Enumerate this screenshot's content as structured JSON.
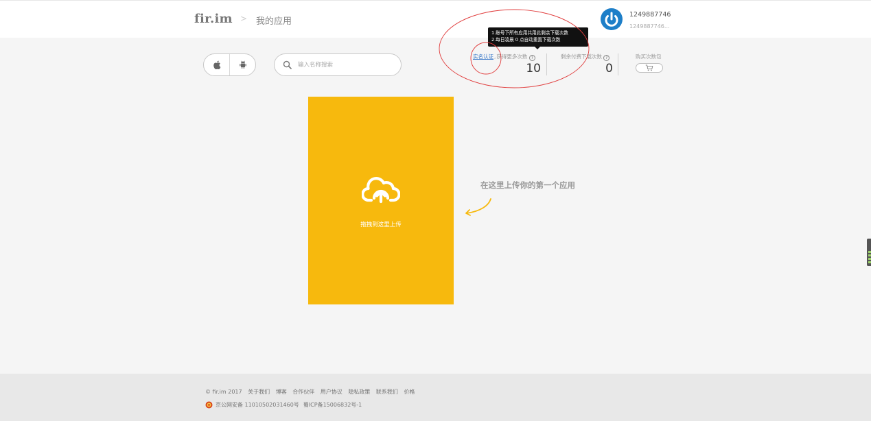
{
  "header": {
    "logo": "fir.im",
    "breadcrumb_separator": ">",
    "page_title": "我的应用",
    "user": {
      "name": "1249887746",
      "sub": "1249887746..."
    }
  },
  "toolbar": {
    "platforms": [
      {
        "name": "ios",
        "icon": "apple-icon"
      },
      {
        "name": "android",
        "icon": "android-icon"
      }
    ],
    "search": {
      "placeholder": "输入名称搜索",
      "value": ""
    }
  },
  "stats": {
    "verify_link": "实名认证",
    "free_label": "获得更多次数",
    "free_value": "10",
    "paid_label": "剩余付费下载次数",
    "paid_value": "0",
    "buy_label": "购买次数包"
  },
  "tooltip": {
    "line1": "1.账号下所有应用共用此剩余下载次数",
    "line2": "2.每日凌晨 0 点自动重置下载次数"
  },
  "upload": {
    "label": "拖拽到这里上传",
    "hint": "在这里上传你的第一个应用"
  },
  "footer": {
    "copyright": "© fir.im 2017",
    "links": [
      "关于我们",
      "博客",
      "合作伙伴",
      "用户协议",
      "隐私政策",
      "联系我们",
      "价格"
    ],
    "police_record": "京公网安备 11010502031460号",
    "icp": "蜀ICP备15006832号-1"
  },
  "colors": {
    "accent_yellow": "#f7b90d",
    "link_blue": "#3a79c9",
    "annotation_red": "#e03b3b",
    "avatar_blue": "#1e7fc8"
  }
}
